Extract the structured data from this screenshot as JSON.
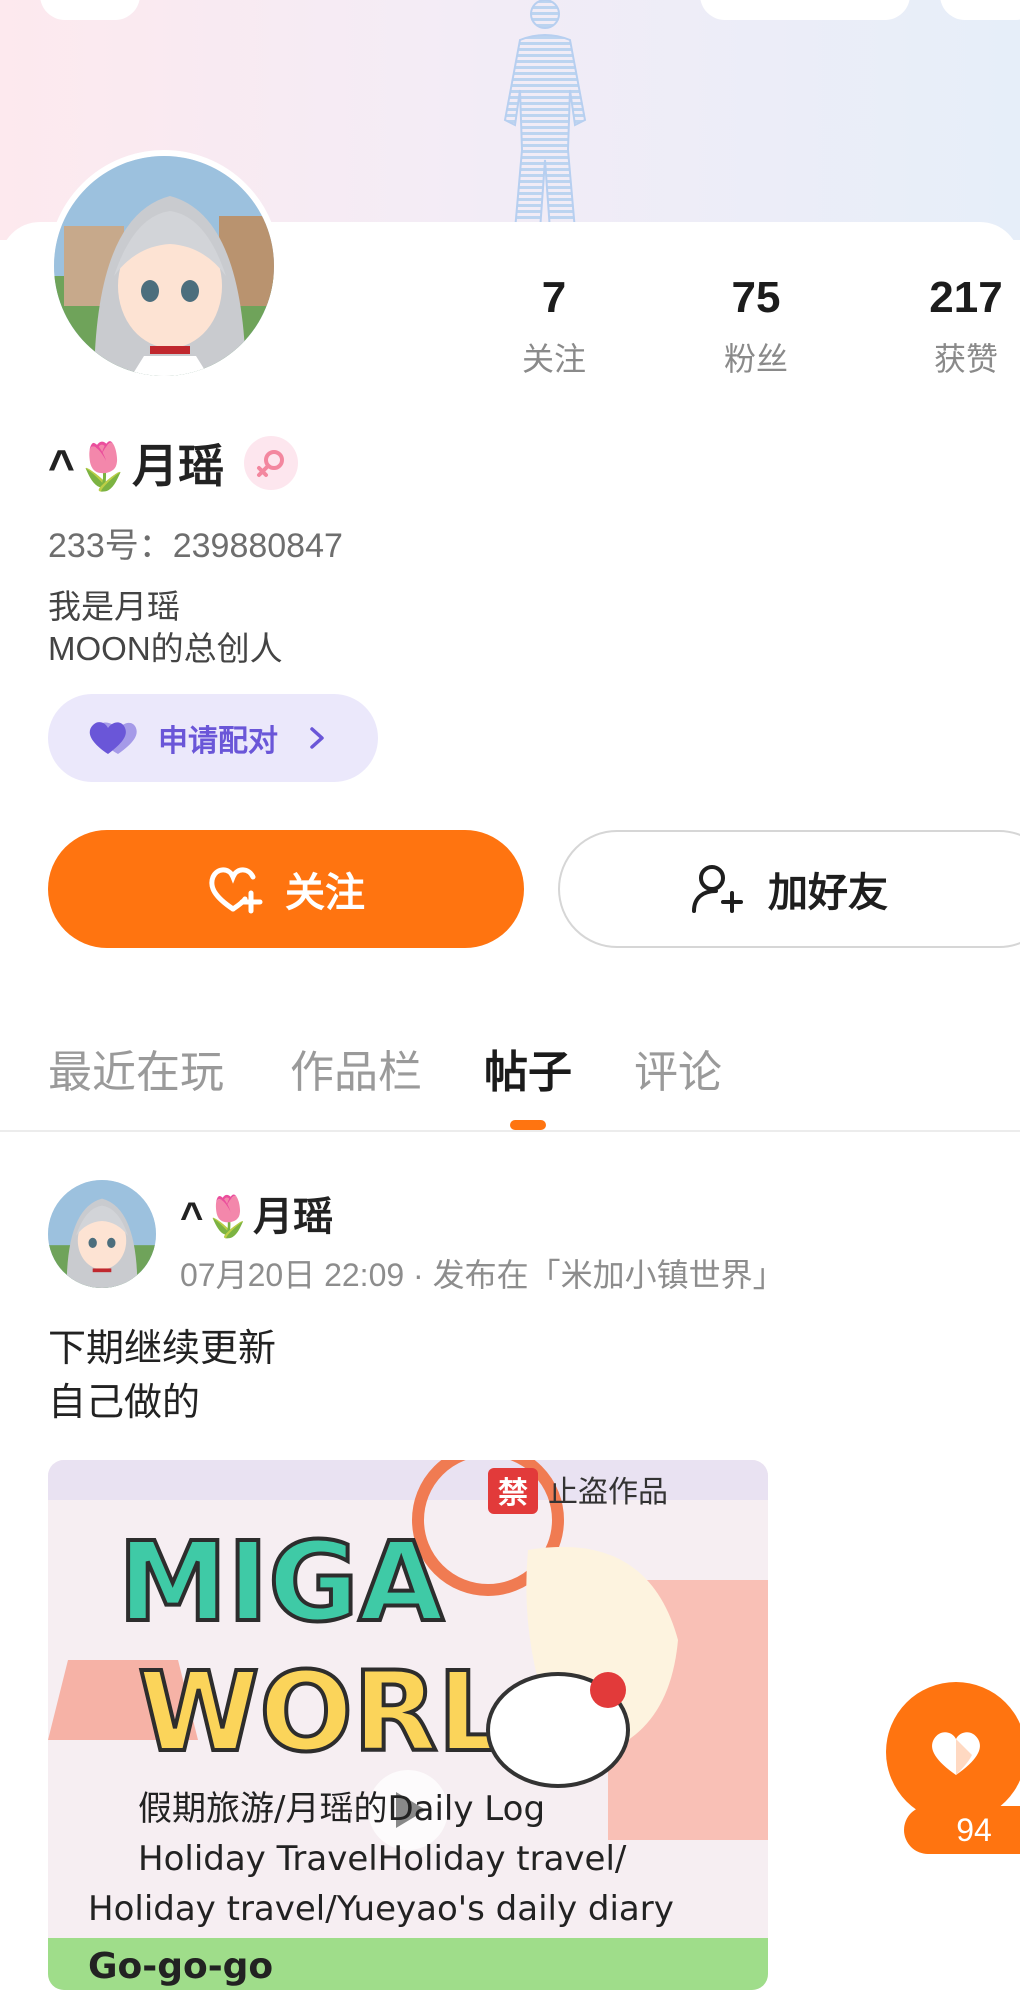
{
  "profile": {
    "name": "^🌷月瑶",
    "uid": "233号：239880847",
    "bio_lines": [
      "我是月瑶",
      "MOON的总创人"
    ]
  },
  "stats": [
    {
      "value": "7",
      "label": "关注"
    },
    {
      "value": "75",
      "label": "粉丝"
    },
    {
      "value": "217",
      "label": "获赞"
    }
  ],
  "pair_button": {
    "label": "申请配对"
  },
  "actions": {
    "follow_label": "关注",
    "add_friend_label": "加好友"
  },
  "tabs": [
    {
      "label": "最近在玩",
      "active": false
    },
    {
      "label": "作品栏",
      "active": false
    },
    {
      "label": "帖子",
      "active": true
    },
    {
      "label": "评论",
      "active": false
    }
  ],
  "post": {
    "author": "^🌷月瑶",
    "meta": "07月20日 22:09 · 发布在「米加小镇世界」",
    "text_lines": [
      "下期继续更新",
      "自己做的"
    ],
    "thumbnail": {
      "banner_text": "禁止盗作品",
      "title_line1": "MIGA",
      "title_line2": "WORL",
      "caption1": "假期旅游/月瑶的Daily Log",
      "caption2": "Holiday TravelHoliday travel/",
      "caption3": "Holiday travel/Yueyao's daily diary",
      "caption4": "Go-go-go"
    }
  },
  "like": {
    "count": "94"
  },
  "colors": {
    "accent": "#ff7410",
    "pair_bg": "#ebe8fb",
    "pair_text": "#6a56d8"
  }
}
